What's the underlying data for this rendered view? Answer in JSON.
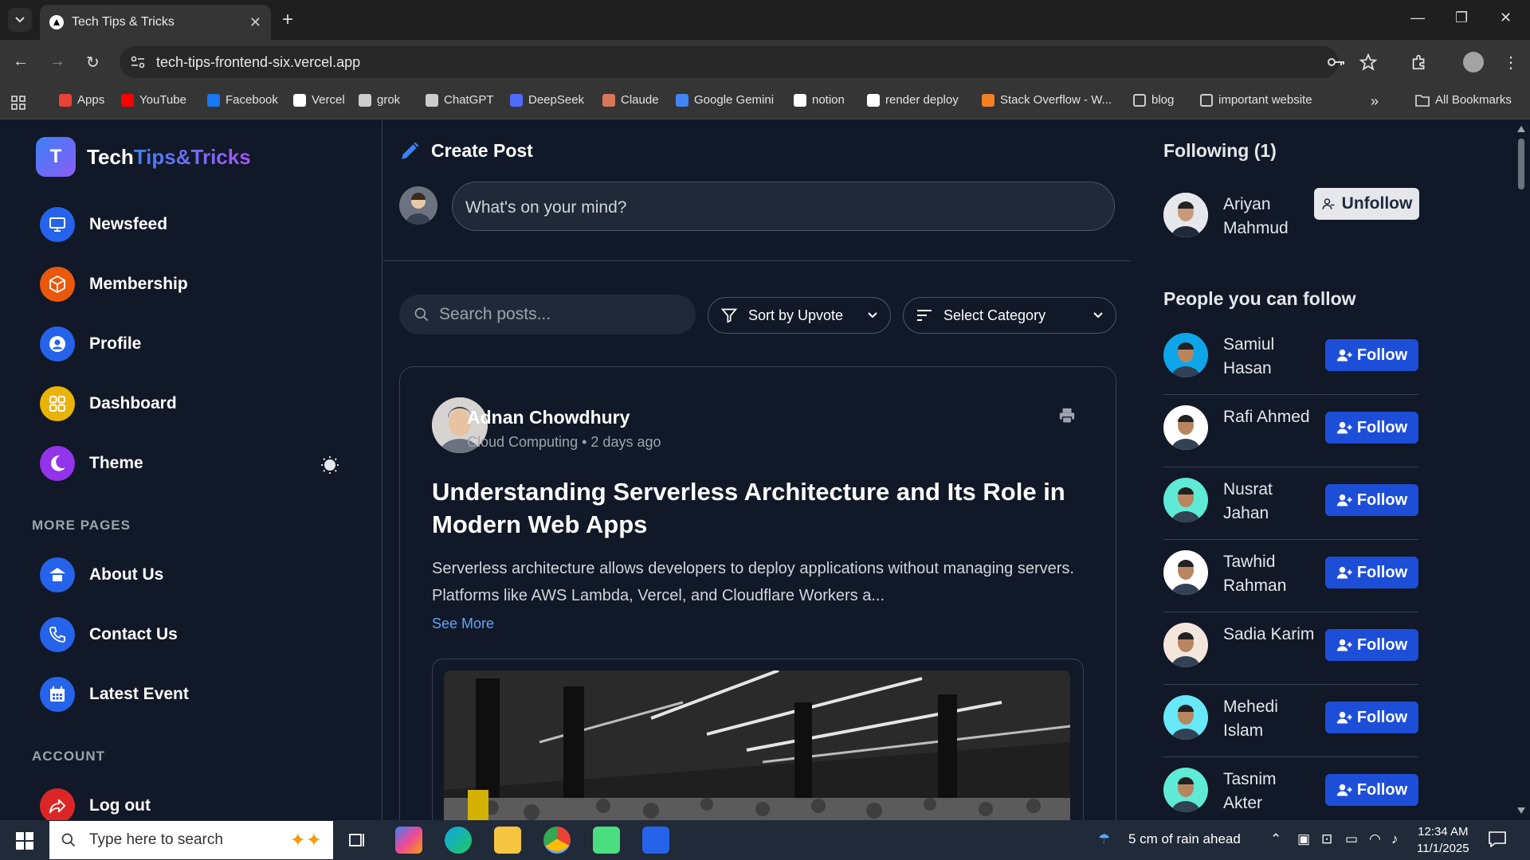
{
  "browser": {
    "tab_title": "Tech Tips & Tricks",
    "url": "tech-tips-frontend-six.vercel.app",
    "bookmarks": [
      {
        "label": "Apps",
        "color": "#ea4335"
      },
      {
        "label": "YouTube",
        "color": "#ff0000"
      },
      {
        "label": "Facebook",
        "color": "#1877f2"
      },
      {
        "label": "Vercel",
        "color": "#ffffff"
      },
      {
        "label": "grok",
        "color": "#cccccc"
      },
      {
        "label": "ChatGPT",
        "color": "#cccccc"
      },
      {
        "label": "DeepSeek",
        "color": "#4d6bfe"
      },
      {
        "label": "Claude",
        "color": "#d97757"
      },
      {
        "label": "Google Gemini",
        "color": "#4285f4"
      },
      {
        "label": "notion",
        "color": "#ffffff"
      },
      {
        "label": "render deploy",
        "color": "#ffffff"
      },
      {
        "label": "Stack Overflow - W...",
        "color": "#f48024"
      },
      {
        "label": "blog",
        "color": "#cccccc"
      },
      {
        "label": "important website",
        "color": "#cccccc"
      }
    ],
    "all_bookmarks": "All Bookmarks"
  },
  "logo": {
    "letter": "T",
    "tech": "Tech",
    "rest": "Tips&Tricks"
  },
  "nav": [
    {
      "label": "Newsfeed",
      "color": "#2563eb"
    },
    {
      "label": "Membership",
      "color": "#ea580c"
    },
    {
      "label": "Profile",
      "color": "#2563eb"
    },
    {
      "label": "Dashboard",
      "color": "#eab308"
    },
    {
      "label": "Theme",
      "color": "#9333ea"
    }
  ],
  "more_pages": {
    "heading": "MORE PAGES",
    "items": [
      "About Us",
      "Contact Us",
      "Latest Event"
    ]
  },
  "account": {
    "heading": "ACCOUNT",
    "items": [
      "Log out"
    ]
  },
  "create_post": {
    "heading": "Create Post",
    "placeholder": "What's on your mind?"
  },
  "filters": {
    "search_placeholder": "Search posts...",
    "sort": "Sort by Upvote",
    "category": "Select Category"
  },
  "post": {
    "author": "Adnan Chowdhury",
    "category": "Cloud Computing",
    "time": "2 days ago",
    "meta_sep": "•",
    "title": "Understanding Serverless Architecture and Its Role in Modern Web Apps",
    "body": "Serverless architecture allows developers to deploy applications without managing servers. Platforms like AWS Lambda, Vercel, and Cloudflare Workers a...",
    "see_more": "See More"
  },
  "following": {
    "heading": "Following (1)",
    "people": [
      {
        "name": "Ariyan Mahmud",
        "action": "Unfollow"
      }
    ]
  },
  "suggestions": {
    "heading": "People you can follow",
    "action": "Follow",
    "people": [
      {
        "name": "Samiul Hasan",
        "color": "#0ea5e9"
      },
      {
        "name": "Rafi Ahmed",
        "color": "#ffffff"
      },
      {
        "name": "Nusrat Jahan",
        "color": "#5eead4"
      },
      {
        "name": "Tawhid Rahman",
        "color": "#ffffff"
      },
      {
        "name": "Sadia Karim",
        "color": "#f5e6dc"
      },
      {
        "name": "Mehedi Islam",
        "color": "#67e8f9"
      },
      {
        "name": "Tasnim Akter",
        "color": "#5eead4"
      }
    ]
  },
  "taskbar": {
    "search_placeholder": "Type here to search",
    "weather": "5 cm of rain ahead",
    "time": "12:34 AM",
    "date": "11/1/2025"
  }
}
